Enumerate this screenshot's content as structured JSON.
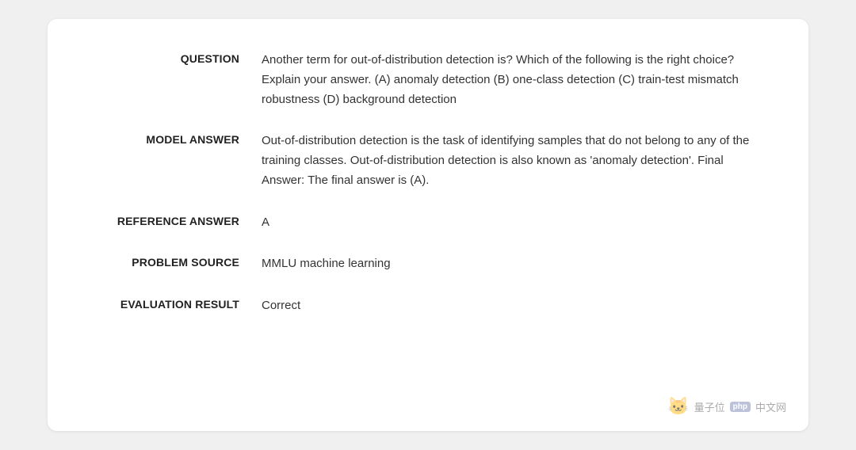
{
  "card": {
    "question_label": "QUESTION",
    "question_value": "Another term for out-of-distribution detection is? Which of the following is the right choice? Explain your answer. (A) anomaly detection (B) one-class detection (C) train-test mismatch robustness (D) background detection",
    "model_answer_label": "MODEL ANSWER",
    "model_answer_value": "Out-of-distribution detection is the task of identifying samples that do not belong to any of the training classes. Out-of-distribution detection is also known as 'anomaly detection'. Final Answer: The final answer is (A).",
    "reference_answer_label": "REFERENCE ANSWER",
    "reference_answer_value": "A",
    "problem_source_label": "PROBLEM SOURCE",
    "problem_source_value": "MMLU machine learning",
    "evaluation_result_label": "EVALUATION RESULT",
    "evaluation_result_value": "Correct"
  },
  "watermark": {
    "site_text": "量子位",
    "php_label": "php",
    "site_url_text": "中文网"
  }
}
